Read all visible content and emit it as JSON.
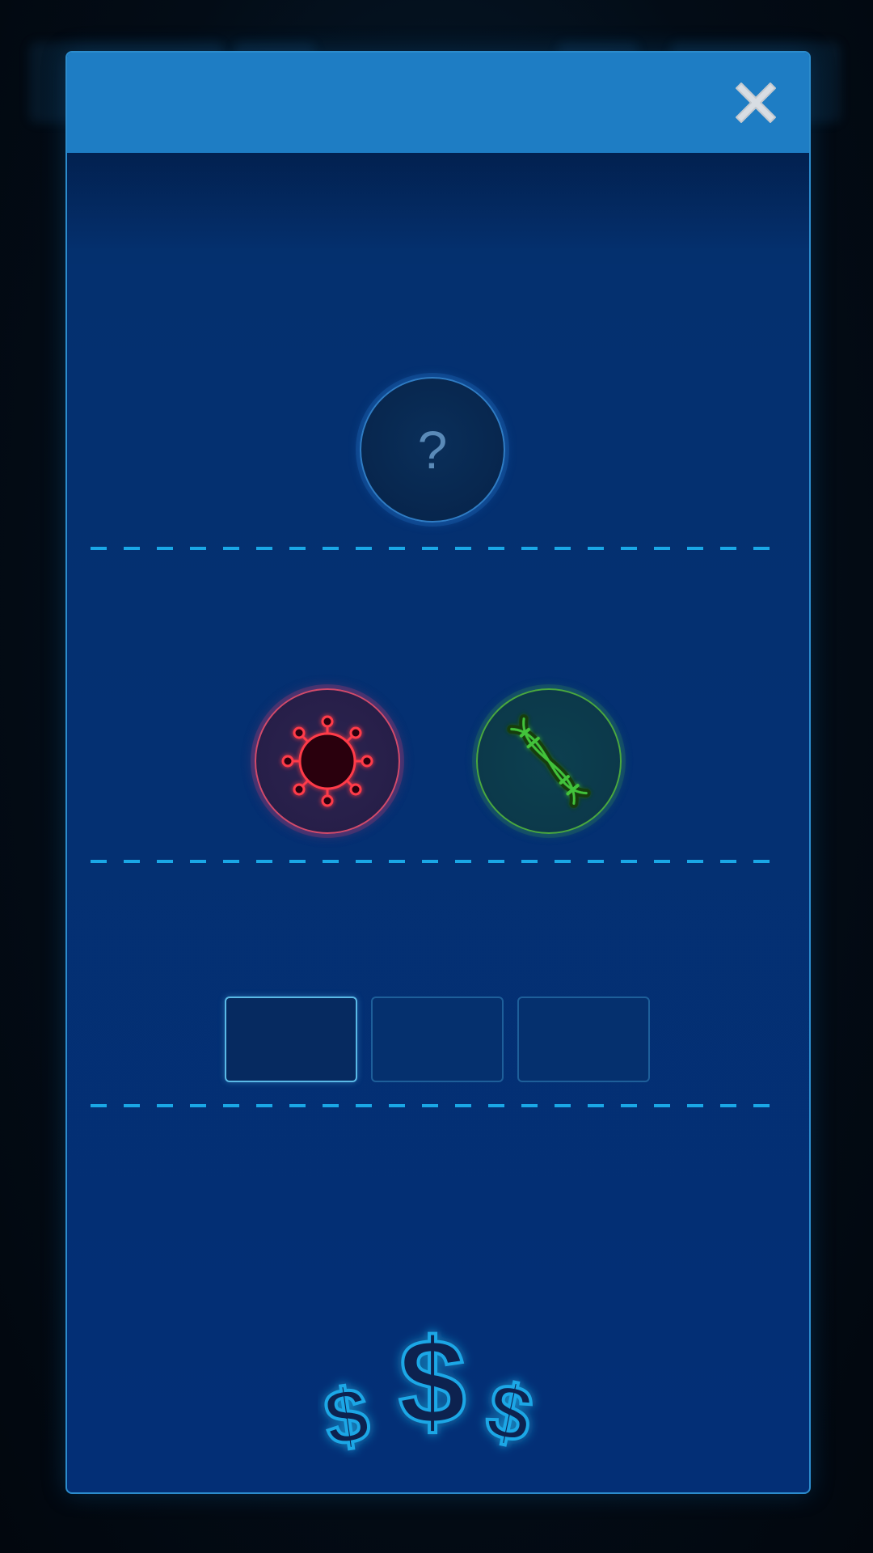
{
  "background": {
    "color": "#04101a"
  },
  "modal": {
    "header_color": "#1e7dc4",
    "panel_color": "#032f76",
    "title": "",
    "close_icon": "close-icon"
  },
  "unknown_slot": {
    "mark": "?",
    "icon": "question-mark-icon"
  },
  "trait_slots": [
    {
      "id": "virus",
      "icon": "virus-icon",
      "color": "#e0334a"
    },
    {
      "id": "dna",
      "icon": "dna-icon",
      "color": "#3ea83a"
    }
  ],
  "option_boxes": [
    {
      "label": "",
      "selected": true
    },
    {
      "label": "",
      "selected": false
    },
    {
      "label": "",
      "selected": false
    }
  ],
  "reward": {
    "icon": "dollar-signs-icon",
    "symbols": [
      "$",
      "$",
      "$"
    ],
    "color": "#1aa7e6"
  },
  "divider_color": "#1aa7e6"
}
